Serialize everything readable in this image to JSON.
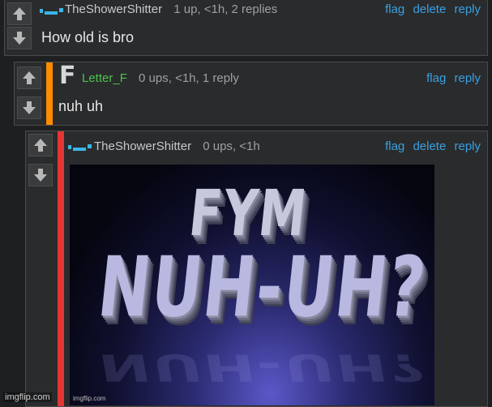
{
  "comments": [
    {
      "username": "TheShowerShitter",
      "stats": "1 up, <1h, 2 replies",
      "actions": [
        "flag",
        "delete",
        "reply"
      ],
      "body": "How old is bro",
      "stripe_color": "",
      "avatar_icon": "squiggle-avatar-icon"
    },
    {
      "username": "Letter_F",
      "stats": "0 ups, <1h, 1 reply",
      "actions": [
        "flag",
        "reply"
      ],
      "body": "nuh uh",
      "stripe_color": "#ff8c00",
      "avatar_icon": "letter-f-avatar-icon",
      "avatar_letter": "F"
    },
    {
      "username": "TheShowerShitter",
      "stats": "0 ups, <1h",
      "actions": [
        "flag",
        "delete",
        "reply"
      ],
      "stripe_color": "#e53535",
      "avatar_icon": "squiggle-avatar-icon",
      "image": {
        "line1": "FYM",
        "line2": "NUH-UH?",
        "watermark": "imgflip.com"
      }
    }
  ],
  "watermark": "imgflip.com",
  "colors": {
    "link": "#3aa0e0",
    "username_green": "#4cc24c",
    "background": "#1e1f21",
    "panel": "#2a2b2d"
  }
}
